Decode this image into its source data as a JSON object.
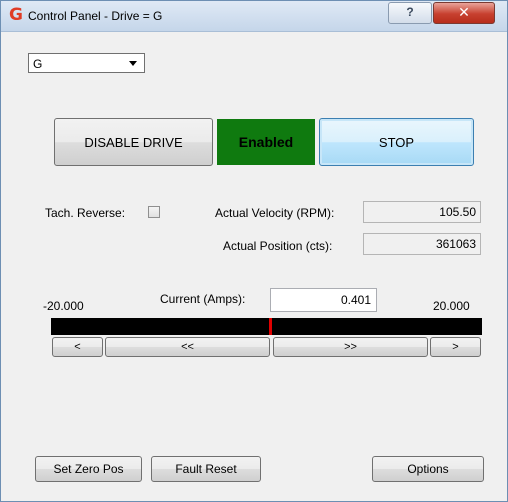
{
  "window": {
    "title": "Control Panel - Drive = G",
    "app_icon": "G",
    "help_label": "?",
    "close_label": "✕"
  },
  "drive_select": {
    "value": "G"
  },
  "buttons": {
    "disable_drive": "DISABLE DRIVE",
    "stop": "STOP",
    "decrement_small": "<",
    "decrement_large": "<<",
    "increment_large": ">>",
    "increment_small": ">",
    "set_zero_pos": "Set Zero Pos",
    "fault_reset": "Fault Reset",
    "options": "Options"
  },
  "status": {
    "text": "Enabled",
    "color": "#0f7a0f"
  },
  "tach_reverse": {
    "label": "Tach. Reverse:",
    "checked": false
  },
  "readouts": {
    "velocity_label": "Actual Velocity (RPM):",
    "velocity_value": "105.50",
    "position_label": "Actual Position (cts):",
    "position_value": "361063"
  },
  "current": {
    "label": "Current (Amps):",
    "value": "0.401",
    "min_label": "-20.000",
    "max_label": "20.000",
    "min": -20,
    "max": 20,
    "level": 0.401,
    "marker_color": "#e00000"
  }
}
